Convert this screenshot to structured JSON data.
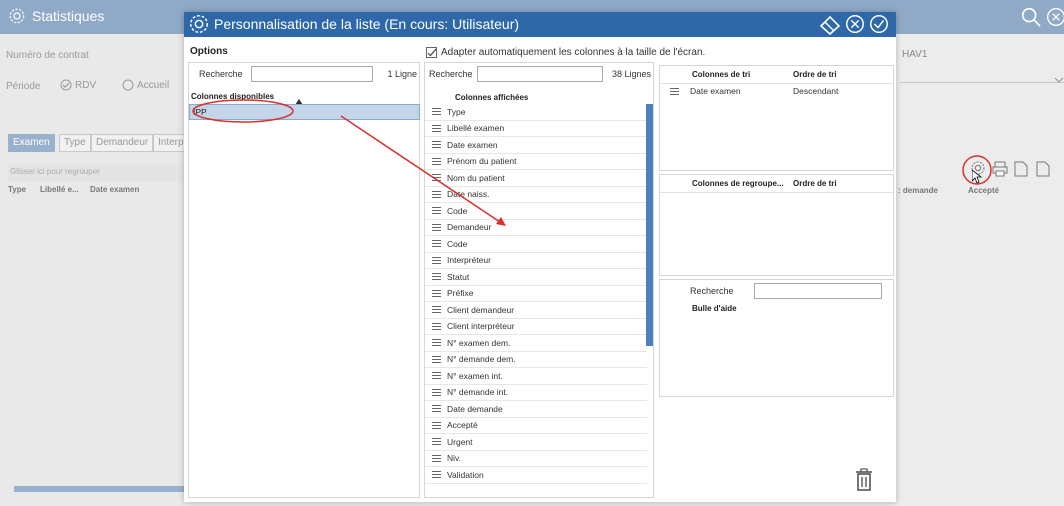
{
  "background": {
    "title": "Statistiques",
    "contract_label": "Numéro de contrat",
    "period_label": "Période",
    "radio_rdv": "RDV",
    "radio_accueil": "Accueil",
    "tabs": [
      "Examen",
      "Type",
      "Demandeur",
      "Interpre"
    ],
    "group_hint": "Glisser ici pour regrouper",
    "grid_columns": [
      "Type",
      "Libellé e...",
      "Date examen"
    ],
    "right_field": "HAV1",
    "right_columns": [
      ": demande",
      "Accepté"
    ]
  },
  "modal": {
    "title": "Personnalisation de la liste (En cours: Utilisateur)",
    "options_label": "Options",
    "autofit_label": "Adapter automatiquement les colonnes à la taille de l'écran.",
    "available": {
      "search_label": "Recherche",
      "search_value": "",
      "count": "1 Ligne",
      "header": "Colonnes disponibles",
      "items": [
        "IPP"
      ]
    },
    "displayed": {
      "search_label": "Recherche",
      "search_value": "",
      "count": "38 Lignes",
      "header": "Colonnes affichées",
      "items": [
        "Type",
        "Libellé examen",
        "Date examen",
        "Prénom du patient",
        "Nom du patient",
        "Date naiss.",
        "Code",
        "Demandeur",
        "Code",
        "Interpréteur",
        "Statut",
        "Préfixe",
        "Client demandeur",
        "Client interpréteur",
        "N° examen dem.",
        "N° demande dem.",
        "N° examen int.",
        "N° demande int.",
        "Date demande",
        "Accepté",
        "Urgent",
        "Niv.",
        "Validation"
      ]
    },
    "sort": {
      "col_header": "Colonnes de tri",
      "order_header": "Ordre de tri",
      "rows": [
        {
          "column": "Date examen",
          "order": "Descendant"
        }
      ]
    },
    "grouping": {
      "col_header": "Colonnes de regroupe...",
      "order_header": "Ordre de tri"
    },
    "help": {
      "search_label": "Recherche",
      "search_value": "",
      "header": "Bulle d'aide"
    }
  },
  "colors": {
    "modal_header": "#2e68a8",
    "bg_header": "#8fa9c7",
    "selected_row": "#c4d5e9",
    "annotation": "#d9302c"
  }
}
